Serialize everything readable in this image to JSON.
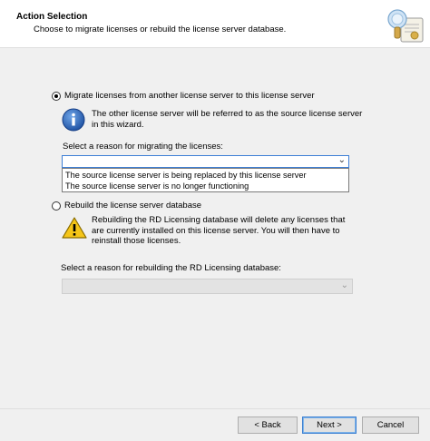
{
  "header": {
    "title": "Action Selection",
    "subtitle": "Choose to migrate licenses or rebuild the license server database.",
    "icon": "license-server-wizard-icon"
  },
  "migrate": {
    "option_label": "Migrate licenses from another license server to this license server",
    "selected": true,
    "info_icon": "info-icon",
    "info_line1": "The other license server will be referred to as the source license server",
    "info_line2": "in this wizard.",
    "reason_label": "Select a reason for migrating the licenses:",
    "dropdown_value": "",
    "dropdown_options": [
      "The source license server is being replaced by this license server",
      "The source license server is no longer functioning"
    ]
  },
  "rebuild": {
    "option_label": "Rebuild the license server database",
    "selected": false,
    "warning_icon": "warning-icon",
    "warning_line1": "Rebuilding the RD Licensing database will delete any licenses that",
    "warning_line2": "are currently installed on this license server. You will then have to",
    "warning_line3": "reinstall those licenses.",
    "reason_label": "Select a reason for rebuilding the RD Licensing database:",
    "dropdown_value": "",
    "dropdown_enabled": false
  },
  "footer": {
    "back_label": "< Back",
    "next_label": "Next >",
    "cancel_label": "Cancel"
  },
  "colors": {
    "accent": "#3d7fd6",
    "background": "#f0f0f0",
    "header_background": "#ffffff"
  }
}
